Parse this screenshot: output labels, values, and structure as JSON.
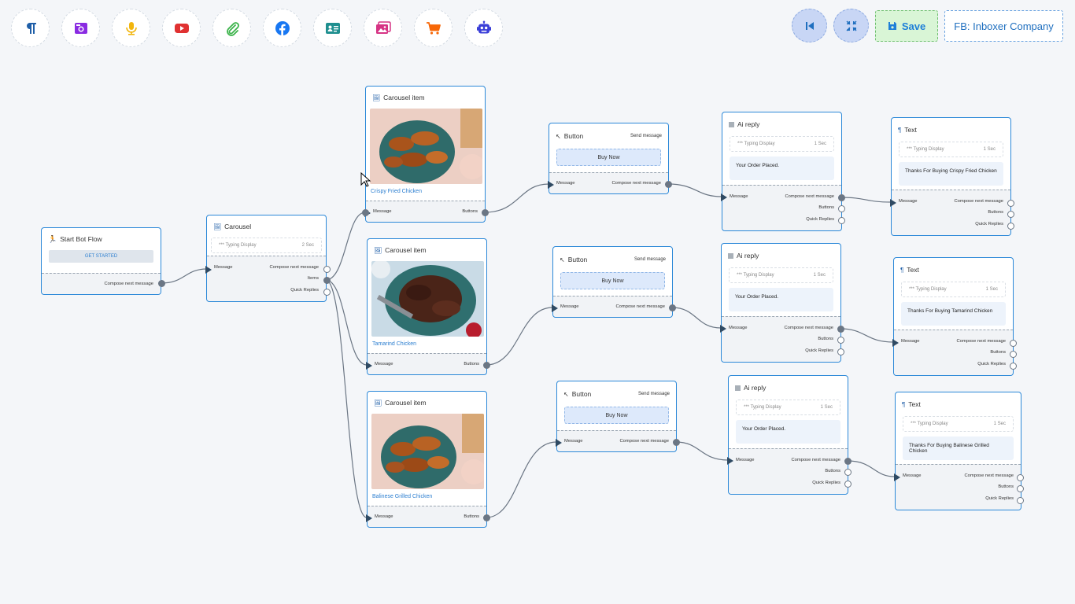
{
  "toolbar": {
    "tools": [
      {
        "name": "text-tool",
        "icon": "paragraph-icon",
        "color": "#1f5fa8"
      },
      {
        "name": "image-tool",
        "icon": "camera-image-icon",
        "color": "#8a2be2"
      },
      {
        "name": "audio-tool",
        "icon": "microphone-icon",
        "color": "#f2b50c"
      },
      {
        "name": "video-tool",
        "icon": "youtube-icon",
        "color": "#e03131"
      },
      {
        "name": "file-tool",
        "icon": "paperclip-icon",
        "color": "#3bb34a"
      },
      {
        "name": "facebook-tool",
        "icon": "facebook-icon",
        "color": "#1877f2"
      },
      {
        "name": "card-tool",
        "icon": "id-card-icon",
        "color": "#1f8f8f"
      },
      {
        "name": "carousel-tool",
        "icon": "images-icon",
        "color": "#d63384"
      },
      {
        "name": "ecommerce-tool",
        "icon": "cart-icon",
        "color": "#f76707"
      },
      {
        "name": "bot-tool",
        "icon": "robot-icon",
        "color": "#3b3fd8"
      }
    ],
    "save_label": "Save",
    "page_label": "FB: Inboxer Company"
  },
  "nodes": {
    "start": {
      "title": "Start Bot Flow",
      "button": "GET STARTED",
      "out": "Compose next message"
    },
    "carousel": {
      "title": "Carousel",
      "typing": "*** Typing Display",
      "delay": "2 Sec",
      "in": "Message",
      "out1": "Compose next message",
      "out2": "Items",
      "out3": "Quick Replies"
    },
    "items": [
      {
        "title": "Carousel item",
        "caption": "Crispy Fried Chicken",
        "in": "Message",
        "out": "Buttons"
      },
      {
        "title": "Carousel item",
        "caption": "Tamarind Chicken",
        "in": "Message",
        "out": "Buttons"
      },
      {
        "title": "Carousel item",
        "caption": "Balinese Grilled Chicken",
        "in": "Message",
        "out": "Buttons"
      }
    ],
    "buttons": [
      {
        "title": "Button",
        "action": "Send message",
        "label": "Buy Now",
        "in": "Message",
        "out": "Compose next message"
      },
      {
        "title": "Button",
        "action": "Send message",
        "label": "Buy Now",
        "in": "Message",
        "out": "Compose next message"
      },
      {
        "title": "Button",
        "action": "Send message",
        "label": "Buy Now",
        "in": "Message",
        "out": "Compose next message"
      }
    ],
    "ai": [
      {
        "title": "Ai reply",
        "typing": "*** Typing Display",
        "delay": "1 Sec",
        "text": "Your Order Placed.",
        "in": "Message",
        "out1": "Compose next message",
        "out2": "Buttons",
        "out3": "Quick Replies"
      },
      {
        "title": "Ai reply",
        "typing": "*** Typing Display",
        "delay": "1 Sec",
        "text": "Your Order Placed.",
        "in": "Message",
        "out1": "Compose next message",
        "out2": "Buttons",
        "out3": "Quick Replies"
      },
      {
        "title": "Ai reply",
        "typing": "*** Typing Display",
        "delay": "1 Sec",
        "text": "Your Order Placed.",
        "in": "Message",
        "out1": "Compose next message",
        "out2": "Buttons",
        "out3": "Quick Replies"
      }
    ],
    "texts": [
      {
        "title": "Text",
        "typing": "*** Typing Display",
        "delay": "1 Sec",
        "text": "Thanks For Buying Crispy Fried Chicken",
        "in": "Message",
        "out1": "Compose next message",
        "out2": "Buttons",
        "out3": "Quick Replies"
      },
      {
        "title": "Text",
        "typing": "*** Typing Display",
        "delay": "1 Sec",
        "text": "Thanks For Buying Tamarind Chicken",
        "in": "Message",
        "out1": "Compose next message",
        "out2": "Buttons",
        "out3": "Quick Replies"
      },
      {
        "title": "Text",
        "typing": "*** Typing Display",
        "delay": "1 Sec",
        "text": "Thanks For Buying Balinese Grilled Chicken",
        "in": "Message",
        "out1": "Compose next message",
        "out2": "Buttons",
        "out3": "Quick Replies"
      }
    ]
  }
}
